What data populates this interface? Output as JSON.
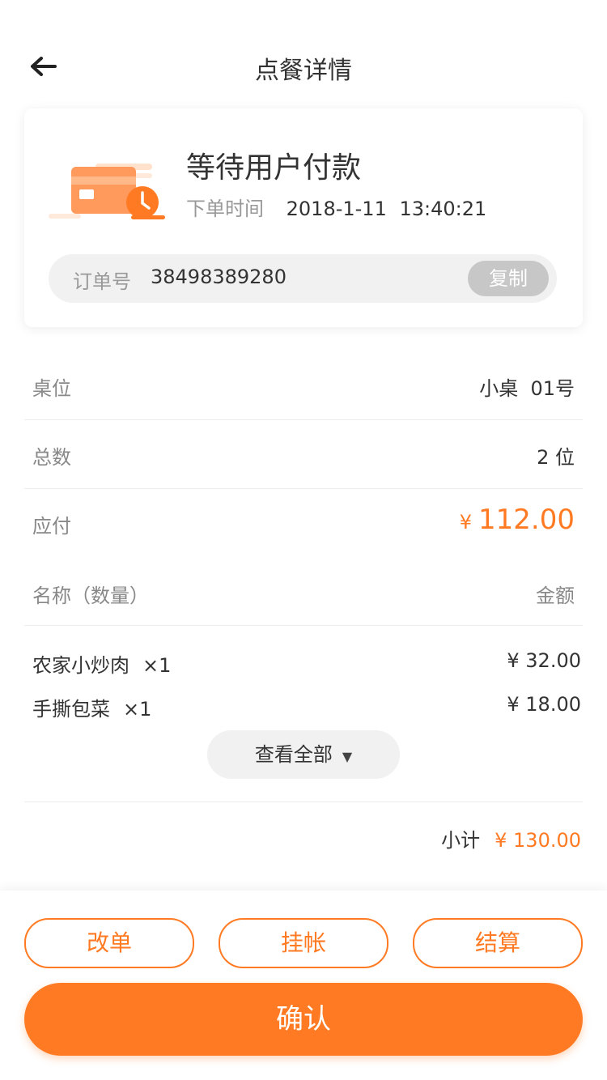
{
  "header": {
    "title": "点餐详情",
    "back_icon": "arrow-left-icon"
  },
  "status": {
    "text": "等待用户付款",
    "time_label": "下单时间",
    "time_value": "2018-1-11 13:40:21",
    "icon": "card-clock-icon",
    "order_label": "订单号",
    "order_no": "38498389280",
    "copy_label": "复制"
  },
  "info": {
    "table_label": "桌位",
    "table_value": "小桌  01号",
    "count_label": "总数",
    "count_value": "2 位",
    "payable_label": "应付",
    "payable_currency": "¥",
    "payable_value": "112.00"
  },
  "list": {
    "name_header": "名称（数量）",
    "amount_header": "金额",
    "items": [
      {
        "name": "农家小炒肉",
        "qty": "×1",
        "price": "¥ 32.00"
      },
      {
        "name": "手撕包菜",
        "qty": "×1",
        "price": "¥ 18.00"
      }
    ],
    "view_all": "查看全部",
    "subtotal_label": "小计",
    "subtotal_value": "¥ 130.00"
  },
  "actions": {
    "modify": "改单",
    "credit": "挂帐",
    "settle": "结算",
    "confirm": "确认"
  },
  "colors": {
    "accent": "#ff7a22",
    "muted": "#999999"
  }
}
